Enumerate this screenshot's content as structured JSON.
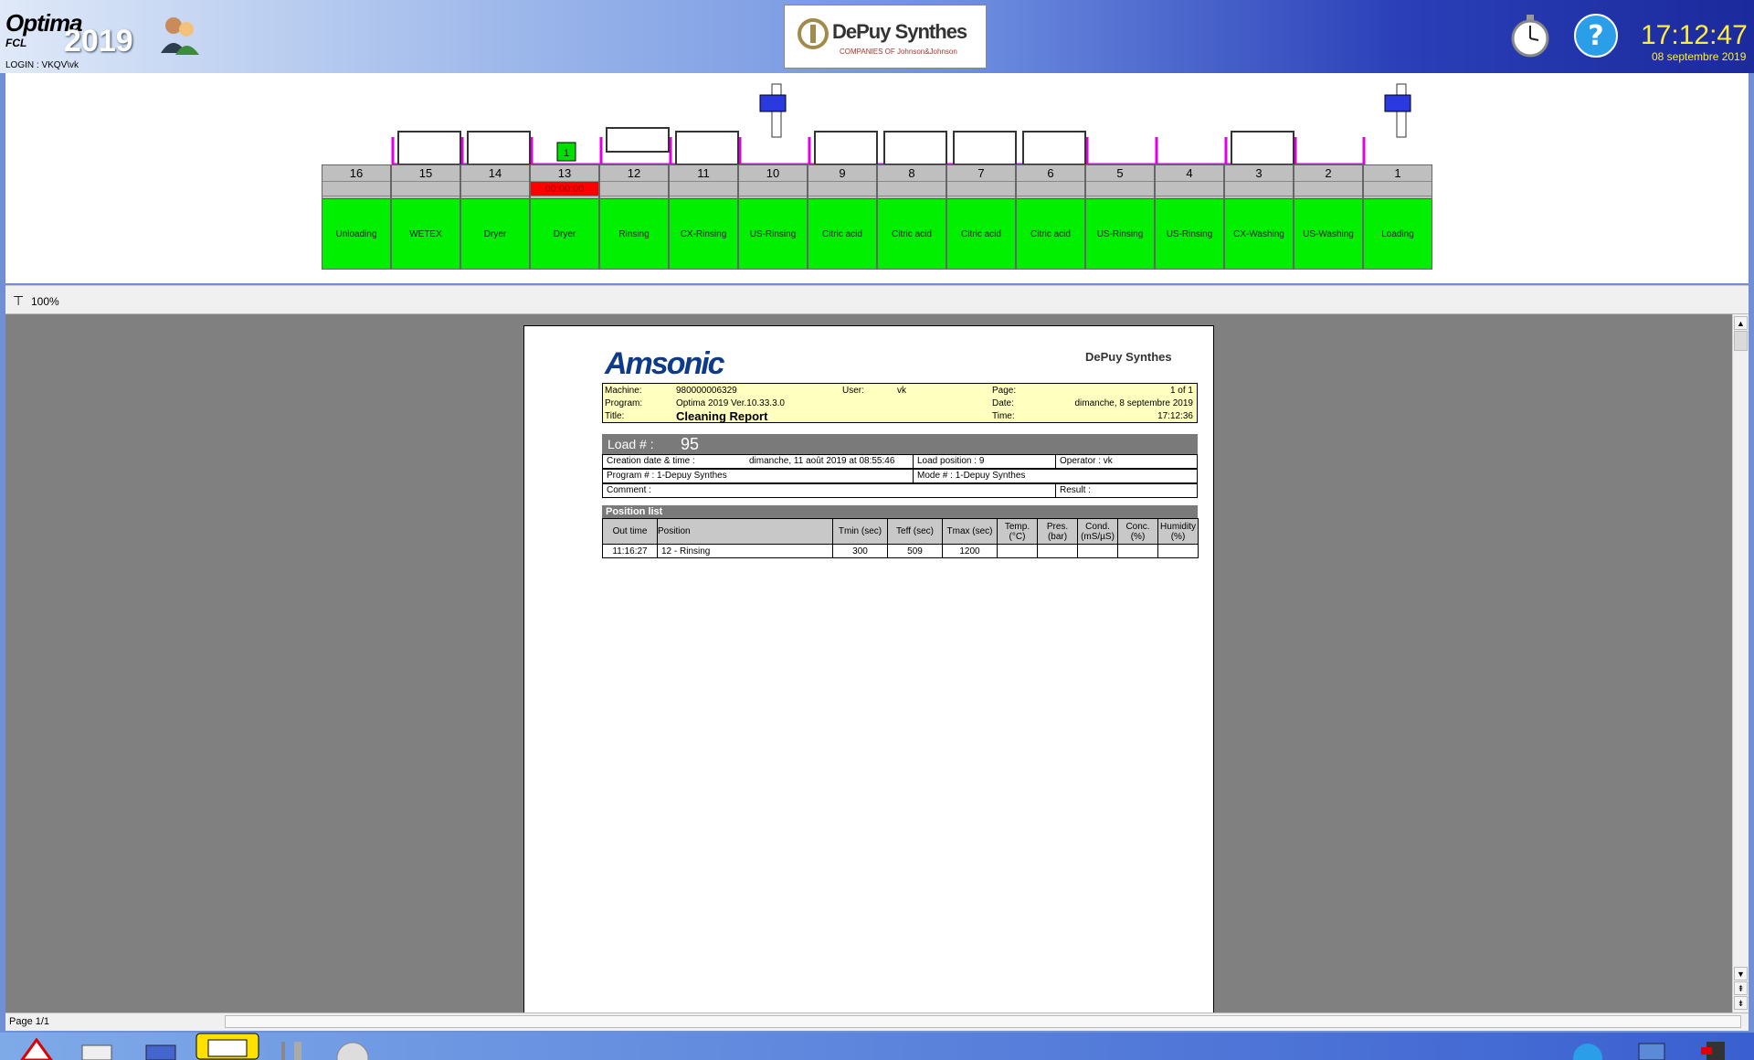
{
  "header": {
    "app_name": "Optima",
    "app_sub": "FCL",
    "app_year": "2019",
    "login": "LOGIN : VKQV\\vk",
    "brand": "DePuy Synthes",
    "brand_tag": "COMPANIES OF Johnson&Johnson",
    "time": "17:12:47",
    "date": "08 septembre 2019"
  },
  "tanks": [
    {
      "num": "16",
      "label": "Unloading",
      "timer": ""
    },
    {
      "num": "15",
      "label": "WETEX",
      "timer": ""
    },
    {
      "num": "14",
      "label": "Dryer",
      "timer": ""
    },
    {
      "num": "13",
      "label": "Dryer",
      "timer": "00:00:00"
    },
    {
      "num": "12",
      "label": "Rinsing",
      "timer": ""
    },
    {
      "num": "11",
      "label": "CX-Rinsing",
      "timer": ""
    },
    {
      "num": "10",
      "label": "US-Rinsing",
      "timer": ""
    },
    {
      "num": "9",
      "label": "Citric acid",
      "timer": ""
    },
    {
      "num": "8",
      "label": "Citric acid",
      "timer": ""
    },
    {
      "num": "7",
      "label": "Citric acid",
      "timer": ""
    },
    {
      "num": "6",
      "label": "Citric acid",
      "timer": ""
    },
    {
      "num": "5",
      "label": "US-Rinsing",
      "timer": ""
    },
    {
      "num": "4",
      "label": "US-Rinsing",
      "timer": ""
    },
    {
      "num": "3",
      "label": "CX-Washing",
      "timer": ""
    },
    {
      "num": "2",
      "label": "US-Washing",
      "timer": ""
    },
    {
      "num": "1",
      "label": "Loading",
      "timer": ""
    }
  ],
  "basket_label": "1",
  "toolbar": {
    "zoom": "100%"
  },
  "report": {
    "logo": "Amsonic",
    "brand": "DePuy Synthes",
    "machine_label": "Machine:",
    "machine": "980000006329",
    "program_label": "Program:",
    "program": "Optima 2019 Ver.10.33.3.0",
    "title_label": "Title:",
    "title": "Cleaning Report",
    "user_label": "User:",
    "user": "vk",
    "page_label": "Page:",
    "page": "1 of 1",
    "date_label": "Date:",
    "date": "dimanche, 8 septembre 2019",
    "time_label": "Time:",
    "time": "17:12:36",
    "load_label": "Load # :",
    "load": "95",
    "creation_label": "Creation date & time :",
    "creation": "dimanche, 11 août 2019 at 08:55:46",
    "load_position": "Load position : 9",
    "operator": "Operator : vk",
    "program_num": "Program # : 1-Depuy Synthes",
    "mode_num": "Mode # : 1-Depuy Synthes",
    "comment": "Comment :",
    "result": "Result :",
    "position_list": "Position list",
    "columns": [
      "Out time",
      "Position",
      "Tmin (sec)",
      "Teff (sec)",
      "Tmax (sec)",
      "Temp. (°C)",
      "Pres. (bar)",
      "Cond. (mS/µS)",
      "Conc. (%)",
      "Humidity (%)"
    ],
    "rows": [
      [
        "11:16:27",
        "12 - Rinsing",
        "300",
        "509",
        "1200",
        "",
        "",
        "",
        "",
        ""
      ]
    ]
  },
  "status": {
    "page": "Page 1/1"
  }
}
